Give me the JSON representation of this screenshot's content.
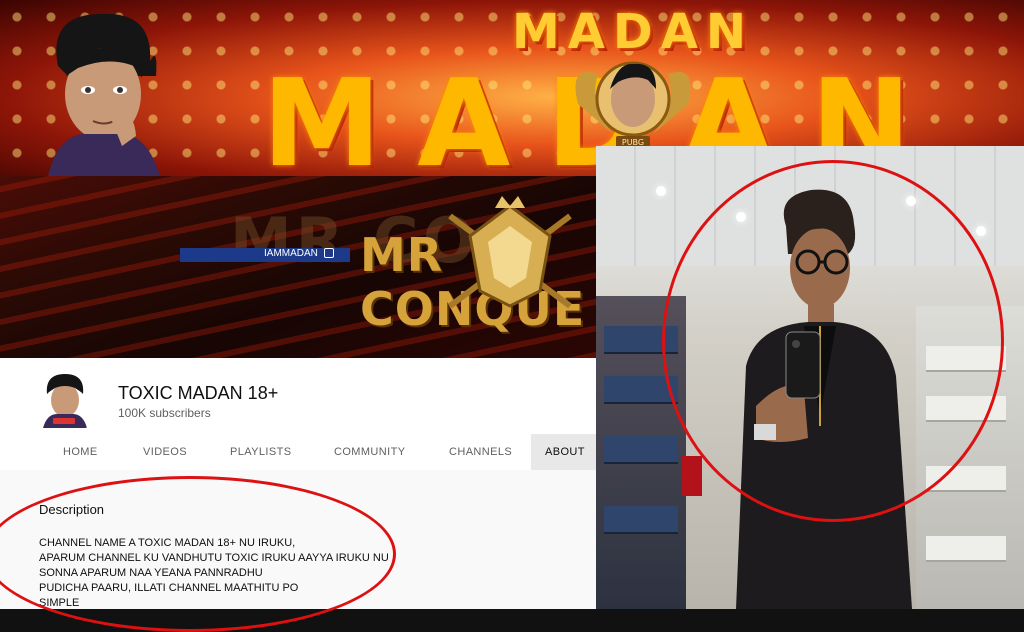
{
  "banner_top": {
    "word_small": "MADAN",
    "word_big": "MADAN",
    "emblem_tag": "PUBG"
  },
  "banner_mid": {
    "ghost_text": "MR CO",
    "title": "MR CONQUE",
    "handle": "IAMMADAN"
  },
  "channel": {
    "name": "TOXIC MADAN 18+",
    "subscribers": "100K subscribers",
    "tabs": [
      {
        "label": "HOME"
      },
      {
        "label": "VIDEOS"
      },
      {
        "label": "PLAYLISTS"
      },
      {
        "label": "COMMUNITY"
      },
      {
        "label": "CHANNELS"
      },
      {
        "label": "ABOUT"
      }
    ],
    "active_tab": "ABOUT",
    "description_title": "Description",
    "description_lines": [
      "CHANNEL NAME A TOXIC MADAN 18+ NU IRUKU,",
      "APARUM CHANNEL KU VANDHUTU TOXIC IRUKU AAYYA IRUKU NU",
      "SONNA APARUM NAA YEANA PANNRADHU",
      "PUDICHA PAARU, ILLATI CHANNEL MAATHITU PO",
      "SIMPLE"
    ]
  },
  "colors": {
    "highlight_circle": "#dd1111",
    "tab_active_bg": "#e8e8e8",
    "banner_gold": "#ffcc33"
  },
  "icons": [
    "instagram-icon",
    "avatar-art",
    "pubg-emblem",
    "conqueror-crest"
  ]
}
